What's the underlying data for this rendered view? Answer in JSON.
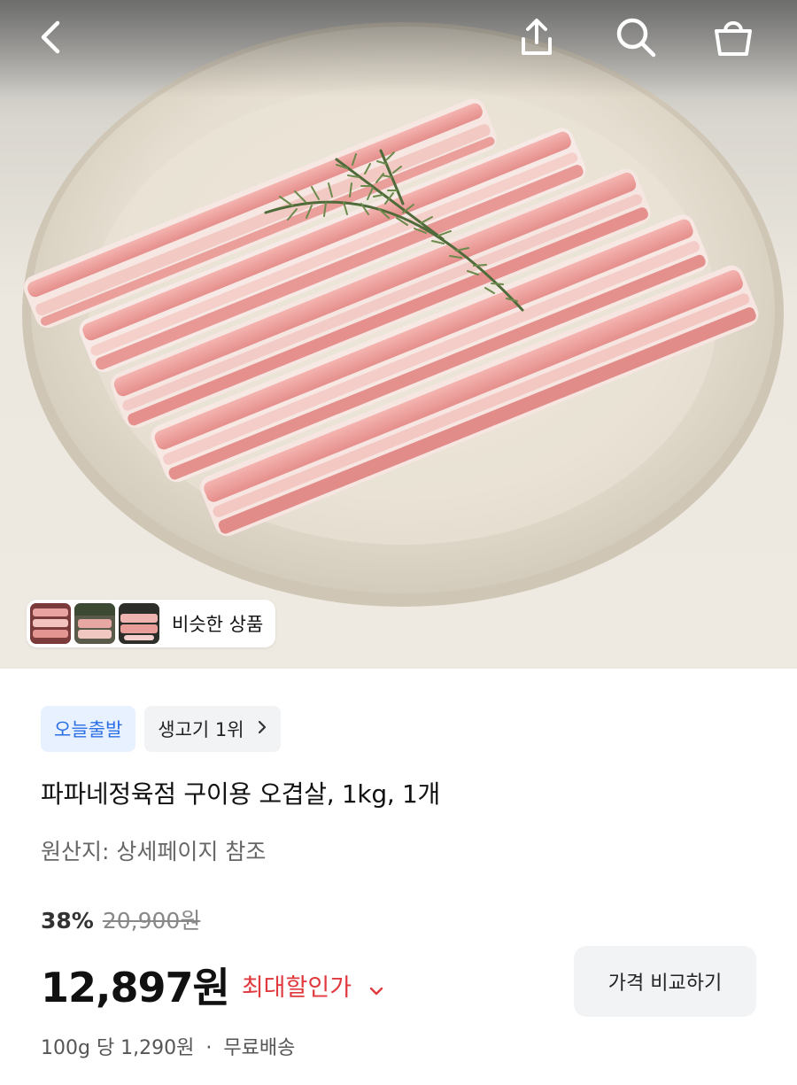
{
  "topbar": {
    "back_icon": "chevron-left-icon",
    "share_icon": "share-upload-icon",
    "search_icon": "search-icon",
    "cart_icon": "shopping-bag-icon"
  },
  "similar": {
    "label": "비슷한 상품"
  },
  "badges": {
    "delivery": "오늘출발",
    "rank": "생고기 1위"
  },
  "product": {
    "title": "파파네정육점 구이용 오겹살, 1kg, 1개",
    "origin": "원산지: 상세페이지 참조",
    "discount_percent": "38%",
    "original_price": "20,900원",
    "sale_price": "12,897원",
    "max_discount_label": "최대할인가",
    "compare_button": "가격 비교하기",
    "unit_price": "100g 당 1,290원",
    "shipping": "무료배송",
    "separator": "·"
  },
  "colors": {
    "accent_blue": "#2a6fe6",
    "badge_blue_bg": "#e8f1ff",
    "discount_red": "#e0393e"
  }
}
